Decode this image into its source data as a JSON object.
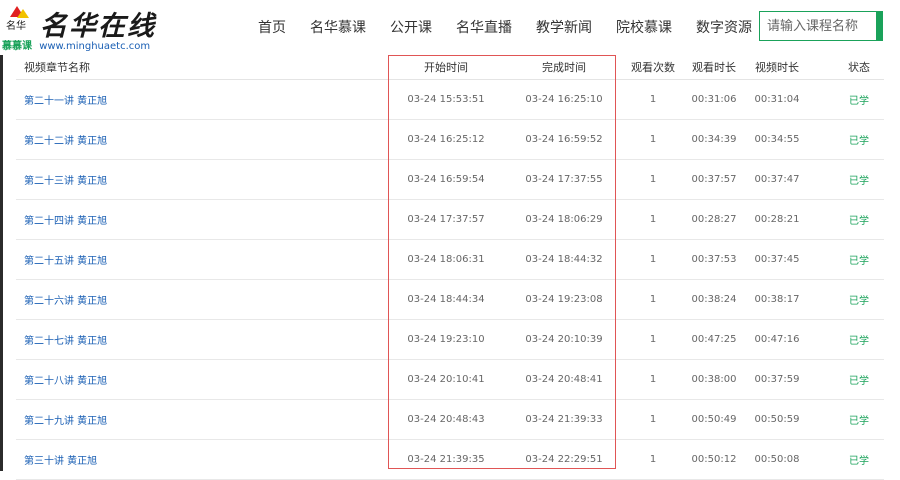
{
  "logo": {
    "seal_text": "名华",
    "brand": "名华在线",
    "submark": "慕慕课",
    "url": "www.minghuaetc.com"
  },
  "nav": {
    "items": [
      "首页",
      "名华慕课",
      "公开课",
      "名华直播",
      "教学新闻",
      "院校慕课",
      "数字资源"
    ]
  },
  "search": {
    "placeholder": "请输入课程名称",
    "value": ""
  },
  "colors": {
    "accent": "#1aa25a",
    "link": "#1a5fb4",
    "highlight_border": "#e05555"
  },
  "table": {
    "headers": {
      "name": "视频章节名称",
      "start": "开始时间",
      "end": "完成时间",
      "count": "观看次数",
      "watch": "观看时长",
      "video": "视频时长",
      "status": "状态"
    },
    "rows": [
      {
        "name": "第二十一讲 黄正旭",
        "start": "03-24 15:53:51",
        "end": "03-24 16:25:10",
        "count": "1",
        "watch": "00:31:06",
        "video": "00:31:04",
        "status": "已学"
      },
      {
        "name": "第二十二讲 黄正旭",
        "start": "03-24 16:25:12",
        "end": "03-24 16:59:52",
        "count": "1",
        "watch": "00:34:39",
        "video": "00:34:55",
        "status": "已学"
      },
      {
        "name": "第二十三讲 黄正旭",
        "start": "03-24 16:59:54",
        "end": "03-24 17:37:55",
        "count": "1",
        "watch": "00:37:57",
        "video": "00:37:47",
        "status": "已学"
      },
      {
        "name": "第二十四讲 黄正旭",
        "start": "03-24 17:37:57",
        "end": "03-24 18:06:29",
        "count": "1",
        "watch": "00:28:27",
        "video": "00:28:21",
        "status": "已学"
      },
      {
        "name": "第二十五讲 黄正旭",
        "start": "03-24 18:06:31",
        "end": "03-24 18:44:32",
        "count": "1",
        "watch": "00:37:53",
        "video": "00:37:45",
        "status": "已学"
      },
      {
        "name": "第二十六讲 黄正旭",
        "start": "03-24 18:44:34",
        "end": "03-24 19:23:08",
        "count": "1",
        "watch": "00:38:24",
        "video": "00:38:17",
        "status": "已学"
      },
      {
        "name": "第二十七讲 黄正旭",
        "start": "03-24 19:23:10",
        "end": "03-24 20:10:39",
        "count": "1",
        "watch": "00:47:25",
        "video": "00:47:16",
        "status": "已学"
      },
      {
        "name": "第二十八讲 黄正旭",
        "start": "03-24 20:10:41",
        "end": "03-24 20:48:41",
        "count": "1",
        "watch": "00:38:00",
        "video": "00:37:59",
        "status": "已学"
      },
      {
        "name": "第二十九讲 黄正旭",
        "start": "03-24 20:48:43",
        "end": "03-24 21:39:33",
        "count": "1",
        "watch": "00:50:49",
        "video": "00:50:59",
        "status": "已学"
      },
      {
        "name": "第三十讲 黄正旭",
        "start": "03-24 21:39:35",
        "end": "03-24 22:29:51",
        "count": "1",
        "watch": "00:50:12",
        "video": "00:50:08",
        "status": "已学"
      }
    ]
  }
}
